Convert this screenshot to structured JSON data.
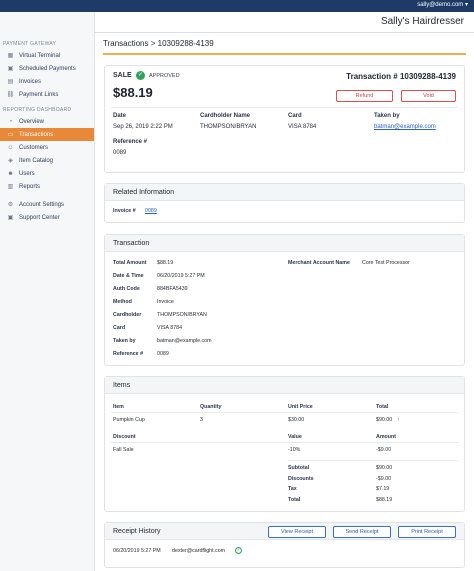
{
  "topbar": {
    "user": "sally@demo.com",
    "caret": "▾"
  },
  "sidebar": {
    "payment_gateway": "PAYMENT GATEWAY",
    "items_pg": [
      "Virtual Terminal",
      "Scheduled Payments",
      "Invoices",
      "Payment Links"
    ],
    "reporting": "REPORTING DASHBOARD",
    "items_rd": [
      "Overview",
      "Transactions",
      "Customers",
      "Item Catalog",
      "Users",
      "Reports"
    ],
    "items_other": [
      "Account Settings",
      "Support Center"
    ]
  },
  "header": {
    "business": "Sally's Hairdresser"
  },
  "breadcrumb": "Transactions > 10309288-4139",
  "summary": {
    "type": "SALE",
    "status": "APPROVED",
    "amount": "$88.19",
    "txn_label": "Transaction # 10309288-4139",
    "refund": "Refund",
    "void": "Void",
    "date_label": "Date",
    "date_value": "Sep 26, 2019 2:22 PM",
    "cardholder_label": "Cardholder Name",
    "cardholder_value": "THOMPSON/BRYAN",
    "card_label": "Card",
    "card_value": "VISA 8784",
    "taken_label": "Taken by",
    "taken_value": "batman@example.com",
    "ref_label": "Reference #",
    "ref_value": "0089"
  },
  "related": {
    "title": "Related Information",
    "invoice_label": "Invoice #",
    "invoice_value": "0089"
  },
  "transaction": {
    "title": "Transaction",
    "rows": [
      {
        "label": "Total Amount",
        "value": "$88.19"
      },
      {
        "label": "Date & Time",
        "value": "06/20/2019 5:27 PM"
      },
      {
        "label": "Auth Code",
        "value": "884BFA5439"
      },
      {
        "label": "Method",
        "value": "Invoice"
      },
      {
        "label": "Cardholder",
        "value": "THOMPSON/BRYAN"
      },
      {
        "label": "Card",
        "value": "VISA 8784"
      },
      {
        "label": "Taken by",
        "value": "batman@example.com"
      },
      {
        "label": "Reference #",
        "value": "0089"
      }
    ],
    "merchant_label": "Merchant Account Name",
    "merchant_value": "Core Test Processor"
  },
  "items": {
    "title": "Items",
    "headers": [
      "Item",
      "Quantity",
      "Unit Price",
      "Total"
    ],
    "row": [
      "Pumpkin Cup",
      "3",
      "$30.00",
      "$90.00"
    ],
    "row_icon": "↑",
    "discount_headers": [
      "Discount",
      "Value",
      "Amount"
    ],
    "discount_row": [
      "Fall Sale",
      "-10%",
      "-$9.00"
    ],
    "totals": [
      {
        "label": "Subtotal",
        "value": "$90.00"
      },
      {
        "label": "Discounts",
        "value": "-$9.00"
      },
      {
        "label": "Tax",
        "value": "$7.19"
      },
      {
        "label": "Total",
        "value": "$88.19"
      }
    ]
  },
  "receipts": {
    "title": "Receipt History",
    "view": "View Receipt",
    "send": "Send Receipt",
    "print": "Print Receipt",
    "entry_date": "06/20/2019 5:27 PM",
    "entry_email": "dexter@cardflight.com"
  },
  "colors": {
    "accent": "#e8893a",
    "topbar": "#1e3a66",
    "approved": "#2fa35a",
    "danger": "#d65050",
    "link": "#2a62b8"
  }
}
